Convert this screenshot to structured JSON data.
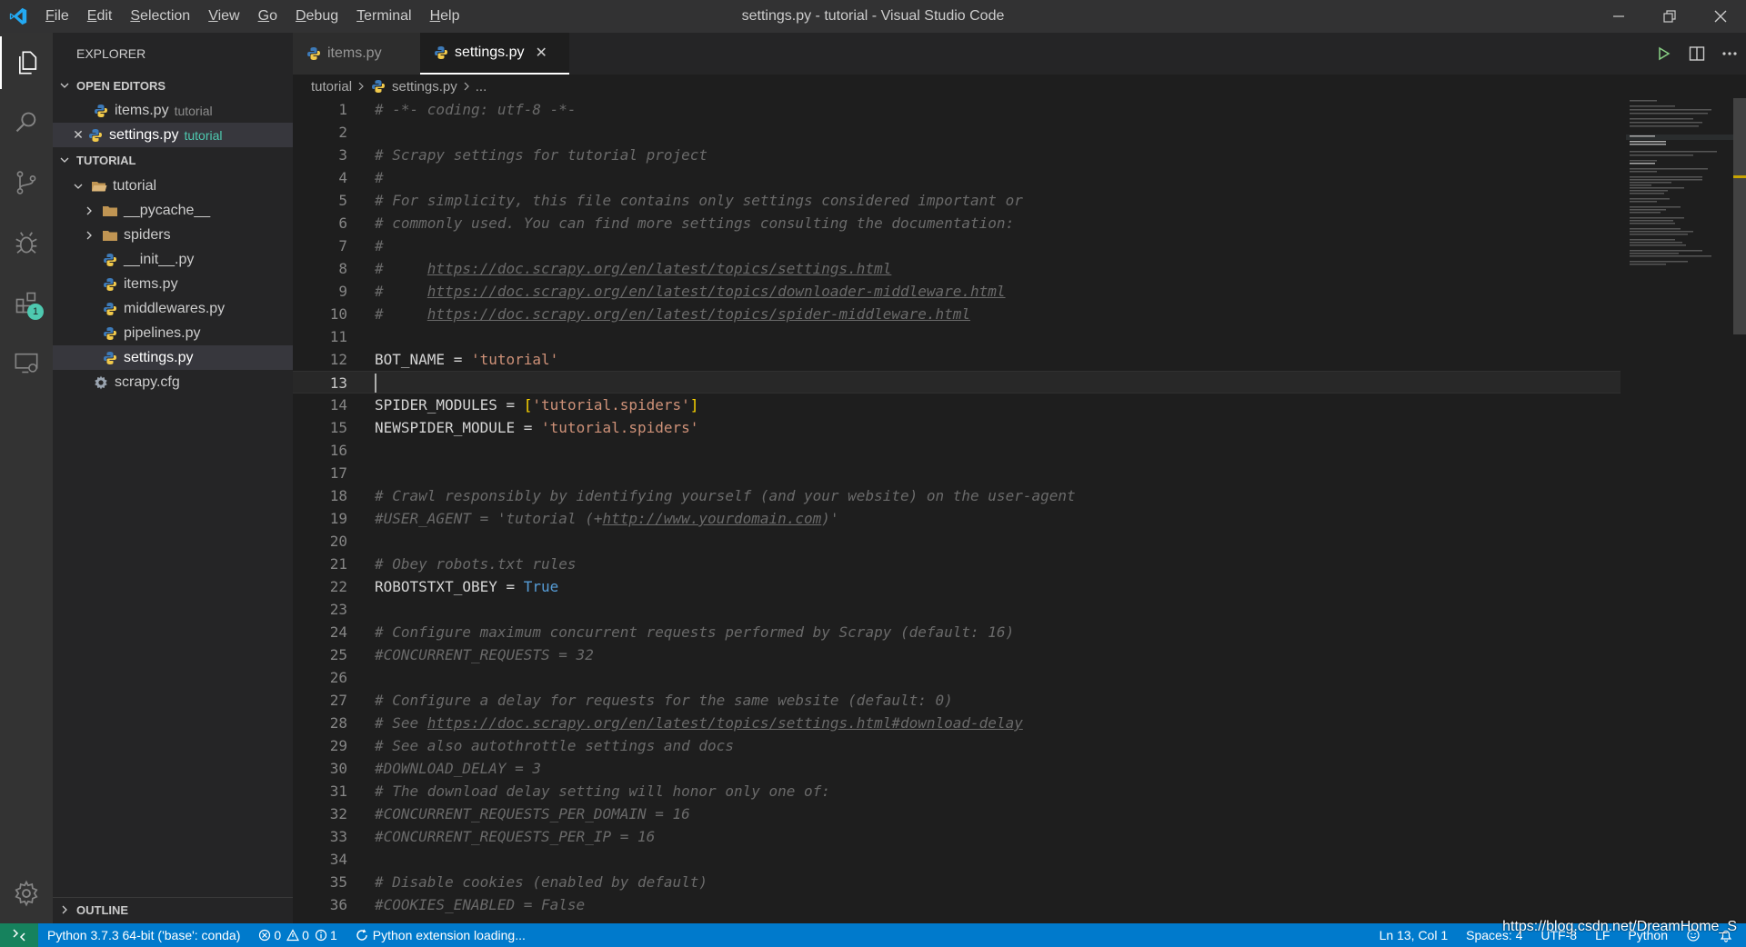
{
  "window": {
    "title": "settings.py - tutorial - Visual Studio Code",
    "menu": [
      "File",
      "Edit",
      "Selection",
      "View",
      "Go",
      "Debug",
      "Terminal",
      "Help"
    ]
  },
  "activity_bar": {
    "items": [
      "files-icon",
      "search-icon",
      "source-control-icon",
      "debug-icon",
      "extensions-icon",
      "remote-explorer-icon"
    ],
    "extensions_badge": "1",
    "bottom": "gear-icon"
  },
  "sidebar": {
    "title": "EXPLORER",
    "open_editors": {
      "label": "OPEN EDITORS",
      "items": [
        {
          "name": "items.py",
          "hint": "tutorial"
        },
        {
          "name": "settings.py",
          "hint": "tutorial"
        }
      ]
    },
    "project": {
      "label": "TUTORIAL",
      "root_folder": "tutorial",
      "children": [
        "__pycache__",
        "spiders",
        "__init__.py",
        "items.py",
        "middlewares.py",
        "pipelines.py",
        "settings.py"
      ],
      "config_file": "scrapy.cfg"
    },
    "outline_label": "OUTLINE"
  },
  "tabs": [
    {
      "label": "items.py"
    },
    {
      "label": "settings.py"
    }
  ],
  "breadcrumb": {
    "folder": "tutorial",
    "file": "settings.py",
    "tail": "..."
  },
  "editor": {
    "cursor_line": 13,
    "lines": [
      "1",
      "2",
      "3",
      "4",
      "5",
      "6",
      "7",
      "8",
      "9",
      "10",
      "11",
      "12",
      "13",
      "14",
      "15",
      "16",
      "17",
      "18",
      "19",
      "20",
      "21",
      "22",
      "23",
      "24",
      "25",
      "26",
      "27",
      "28",
      "29",
      "30",
      "31",
      "32",
      "33",
      "34",
      "35",
      "36"
    ],
    "code": {
      "l1": "# -*- coding: utf-8 -*-",
      "l3": "# Scrapy settings for tutorial project",
      "l4": "#",
      "l5": "# For simplicity, this file contains only settings considered important or",
      "l6": "# commonly used. You can find more settings consulting the documentation:",
      "l7": "#",
      "l8_prefix": "#     ",
      "l8_url": "https://doc.scrapy.org/en/latest/topics/settings.html",
      "l9_prefix": "#     ",
      "l9_url": "https://doc.scrapy.org/en/latest/topics/downloader-middleware.html",
      "l10_prefix": "#     ",
      "l10_url": "https://doc.scrapy.org/en/latest/topics/spider-middleware.html",
      "l12_id": "BOT_NAME",
      "l12_op": " = ",
      "l12_str": "'tutorial'",
      "l14_id": "SPIDER_MODULES",
      "l14_op": " = ",
      "l14_open": "[",
      "l14_str": "'tutorial.spiders'",
      "l14_close": "]",
      "l15_id": "NEWSPIDER_MODULE",
      "l15_op": " = ",
      "l15_str": "'tutorial.spiders'",
      "l18": "# Crawl responsibly by identifying yourself (and your website) on the user-agent",
      "l19_prefix": "#USER_AGENT = 'tutorial (+",
      "l19_url": "http://www.yourdomain.com",
      "l19_suffix": ")'",
      "l21": "# Obey robots.txt rules",
      "l22_id": "ROBOTSTXT_OBEY",
      "l22_op": " = ",
      "l22_kw": "True",
      "l24": "# Configure maximum concurrent requests performed by Scrapy (default: 16)",
      "l25": "#CONCURRENT_REQUESTS = 32",
      "l27": "# Configure a delay for requests for the same website (default: 0)",
      "l28_prefix": "# See ",
      "l28_url": "https://doc.scrapy.org/en/latest/topics/settings.html#download-delay",
      "l29": "# See also autothrottle settings and docs",
      "l30": "#DOWNLOAD_DELAY = 3",
      "l31": "# The download delay setting will honor only one of:",
      "l32": "#CONCURRENT_REQUESTS_PER_DOMAIN = 16",
      "l33": "#CONCURRENT_REQUESTS_PER_IP = 16",
      "l35": "# Disable cookies (enabled by default)",
      "l36": "#COOKIES_ENABLED = False"
    }
  },
  "status_bar": {
    "interpreter": "Python 3.7.3 64-bit ('base': conda)",
    "errors": "0",
    "warnings": "0",
    "infos": "1",
    "loading": "Python extension loading...",
    "position": "Ln 13, Col 1",
    "spaces": "Spaces: 4",
    "encoding": "UTF-8",
    "eol": "LF",
    "language": "Python"
  },
  "watermark": "https://blog.csdn.net/DreamHome_S",
  "colors": {
    "accent": "#007acc",
    "comment": "#6a6a6a",
    "string": "#ce9178",
    "keyword": "#569cd6",
    "bracket": "#ffd700"
  }
}
